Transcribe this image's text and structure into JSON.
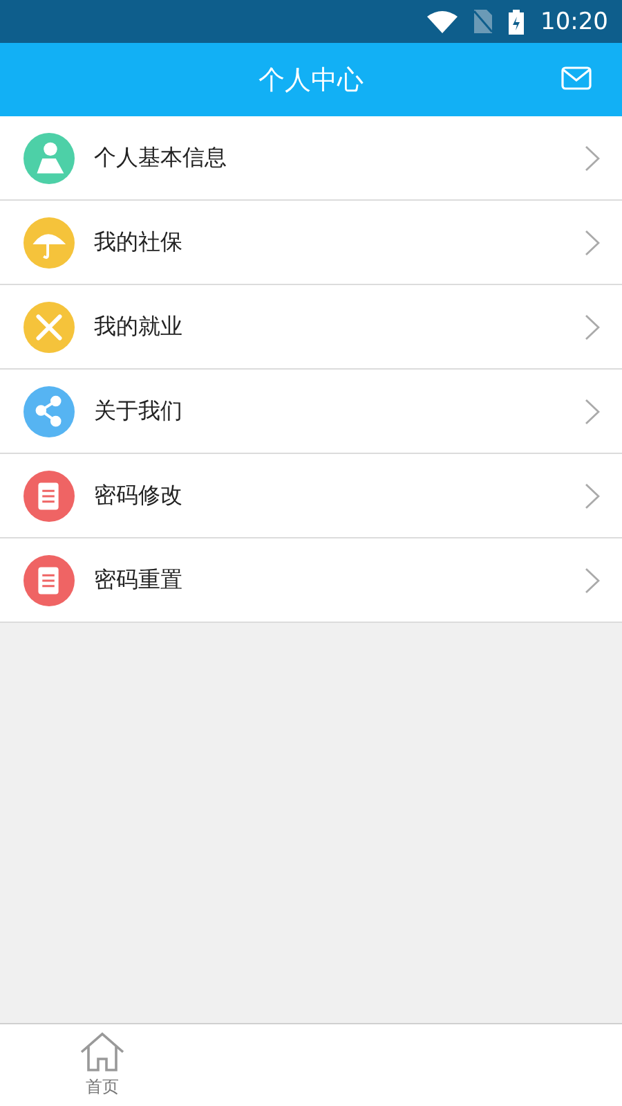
{
  "status_bar": {
    "time": "10:20"
  },
  "header": {
    "title": "个人中心"
  },
  "menu_items": [
    {
      "label": "个人基本信息",
      "kind": "person",
      "color": "#4dd0a7"
    },
    {
      "label": "我的社保",
      "kind": "umbrella",
      "color": "#f5c33b"
    },
    {
      "label": "我的就业",
      "kind": "tools",
      "color": "#f5c33b"
    },
    {
      "label": "关于我们",
      "kind": "share",
      "color": "#56b4f2"
    },
    {
      "label": "密码修改",
      "kind": "document",
      "color": "#ef6464"
    },
    {
      "label": "密码重置",
      "kind": "document",
      "color": "#ef6464"
    }
  ],
  "tab_bar": [
    {
      "label": "首页",
      "kind": "home"
    }
  ]
}
